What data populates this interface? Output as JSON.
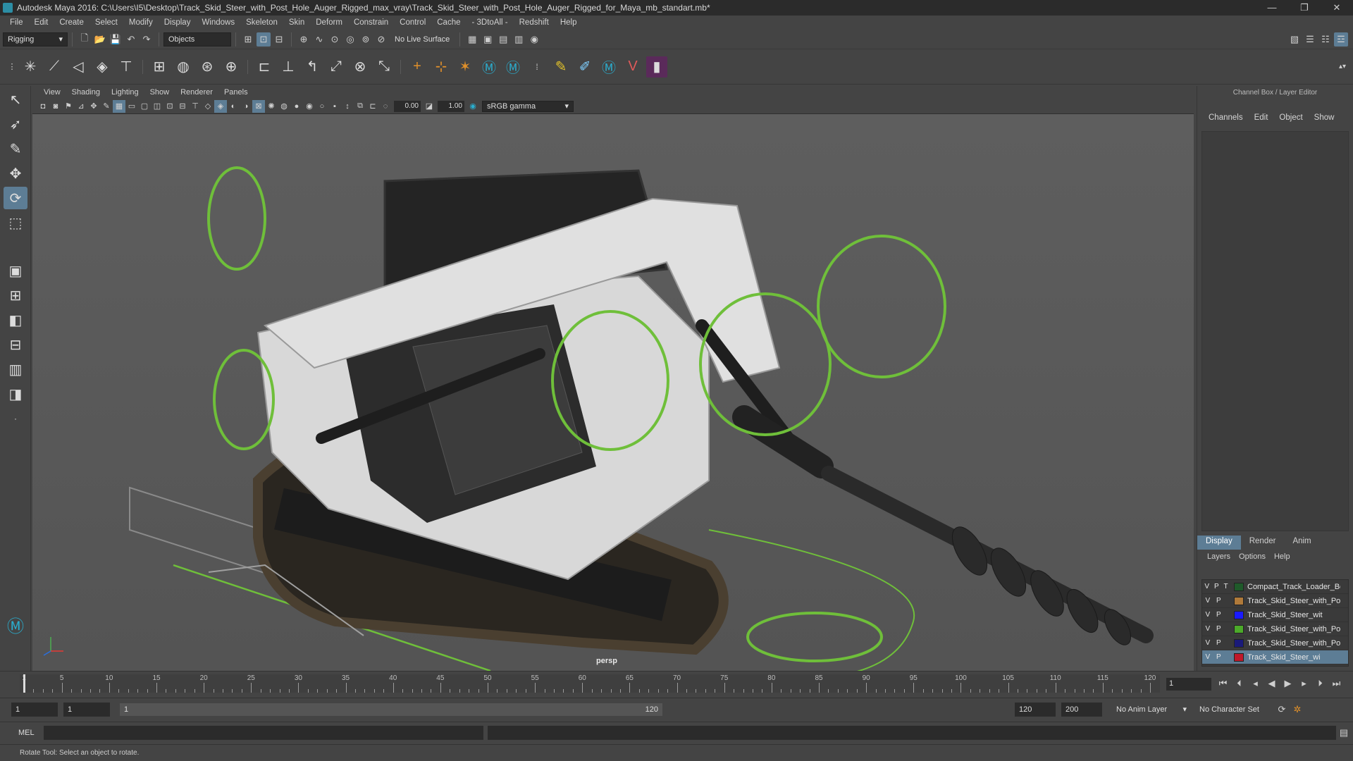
{
  "window": {
    "title": "Autodesk Maya 2016: C:\\Users\\I5\\Desktop\\Track_Skid_Steer_with_Post_Hole_Auger_Rigged_max_vray\\Track_Skid_Steer_with_Post_Hole_Auger_Rigged_for_Maya_mb_standart.mb*",
    "buttons": [
      "—",
      "❐",
      "✕"
    ]
  },
  "menubar": [
    "File",
    "Edit",
    "Create",
    "Select",
    "Modify",
    "Display",
    "Windows",
    "Skeleton",
    "Skin",
    "Deform",
    "Constrain",
    "Control",
    "Cache",
    "- 3DtoAll -",
    "Redshift",
    "Help"
  ],
  "statusline": {
    "menuset": "Rigging",
    "select_mode": "Objects",
    "live_surface": "No Live Surface"
  },
  "panel": {
    "menus": [
      "View",
      "Shading",
      "Lighting",
      "Show",
      "Renderer",
      "Panels"
    ],
    "exposure": "0.00",
    "gamma": "1.00",
    "colorspace": "sRGB gamma",
    "camera": "persp"
  },
  "channelbox": {
    "title": "Channel Box / Layer Editor",
    "menus": [
      "Channels",
      "Edit",
      "Object",
      "Show"
    ]
  },
  "layereditor": {
    "tabs": [
      "Display",
      "Render",
      "Anim"
    ],
    "menus": [
      "Layers",
      "Options",
      "Help"
    ],
    "layers": [
      {
        "v": "V",
        "p": "P",
        "t": "T",
        "color": "#1f5a2a",
        "name": "Compact_Track_Loader_Bo",
        "selected": false
      },
      {
        "v": "V",
        "p": "P",
        "t": "",
        "color": "#b07a3a",
        "name": "Track_Skid_Steer_with_Po",
        "selected": false
      },
      {
        "v": "V",
        "p": "P",
        "t": "",
        "color": "#1a1aff",
        "name": "Track_Skid_Steer_wit",
        "selected": false
      },
      {
        "v": "V",
        "p": "P",
        "t": "",
        "color": "#4caa2a",
        "name": "Track_Skid_Steer_with_Pos",
        "selected": false
      },
      {
        "v": "V",
        "p": "P",
        "t": "",
        "color": "#1a1a7a",
        "name": "Track_Skid_Steer_with_Pos",
        "selected": false
      },
      {
        "v": "V",
        "p": "P",
        "t": "",
        "color": "#c0182a",
        "name": "Track_Skid_Steer_wi",
        "selected": true
      }
    ]
  },
  "timeline": {
    "labels": [
      "1",
      "5",
      "10",
      "15",
      "20",
      "25",
      "30",
      "35",
      "40",
      "45",
      "50",
      "55",
      "60",
      "65",
      "70",
      "75",
      "80",
      "85",
      "90",
      "95",
      "100",
      "105",
      "110",
      "115",
      "120"
    ],
    "current_frame": "1"
  },
  "range": {
    "start": "1",
    "playback_start": "1",
    "slider_start": "1",
    "slider_end": "120",
    "playback_end": "120",
    "end": "200",
    "anim_layer": "No Anim Layer",
    "character_set": "No Character Set"
  },
  "command": {
    "mode": "MEL"
  },
  "help": {
    "text": "Rotate Tool: Select an object to rotate."
  },
  "colors": {
    "accent": "#5d7d95",
    "viewport_bg": "#5a5a5a",
    "rig_controls": "#6fbf3a"
  }
}
